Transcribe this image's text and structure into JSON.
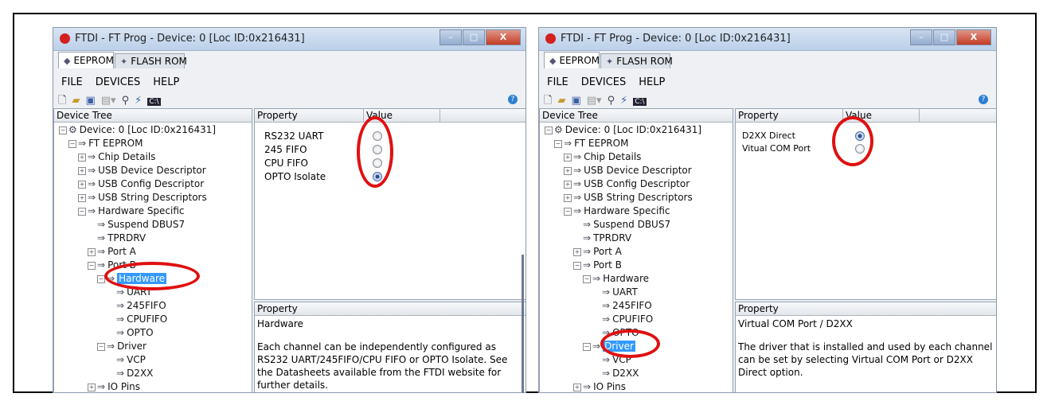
{
  "colors": {
    "highlight": "#e01010",
    "selection": "#3399ff",
    "titlebar": "#c9daef"
  },
  "windows": [
    {
      "title": "FTDI - FT Prog - Device: 0 [Loc ID:0x216431]",
      "controls": [
        "–",
        "□",
        "X"
      ],
      "tabs": [
        "EEPROM",
        "FLASH ROM"
      ],
      "menu": [
        "FILE",
        "DEVICES",
        "HELP"
      ],
      "tree_header": "Device Tree",
      "tree": [
        {
          "label": "Device: 0 [Loc ID:0x216431]",
          "exp": "−",
          "icon": "device-icon"
        },
        {
          "label": "FT EEPROM",
          "exp": "−",
          "icon": "arrow-icon"
        },
        {
          "label": "Chip Details",
          "exp": "+",
          "icon": "arrow-icon"
        },
        {
          "label": "USB Device Descriptor",
          "exp": "+",
          "icon": "arrow-icon"
        },
        {
          "label": "USB Config Descriptor",
          "exp": "+",
          "icon": "arrow-icon"
        },
        {
          "label": "USB String Descriptors",
          "exp": "+",
          "icon": "arrow-icon"
        },
        {
          "label": "Hardware Specific",
          "exp": "−",
          "icon": "arrow-icon"
        },
        {
          "label": "Suspend DBUS7",
          "exp": "",
          "icon": "arrow-icon"
        },
        {
          "label": "TPRDRV",
          "exp": "",
          "icon": "arrow-icon"
        },
        {
          "label": "Port A",
          "exp": "+",
          "icon": "arrow-icon"
        },
        {
          "label": "Port B",
          "exp": "−",
          "icon": "arrow-icon"
        },
        {
          "label": "Hardware",
          "exp": "−",
          "icon": "arrow-icon",
          "selected": true
        },
        {
          "label": "UART",
          "exp": "",
          "icon": "arrow-icon"
        },
        {
          "label": "245FIFO",
          "exp": "",
          "icon": "arrow-icon"
        },
        {
          "label": "CPUFIFO",
          "exp": "",
          "icon": "arrow-icon"
        },
        {
          "label": "OPTO",
          "exp": "",
          "icon": "arrow-icon"
        },
        {
          "label": "Driver",
          "exp": "−",
          "icon": "arrow-icon"
        },
        {
          "label": "VCP",
          "exp": "",
          "icon": "arrow-icon"
        },
        {
          "label": "D2XX",
          "exp": "",
          "icon": "arrow-icon"
        },
        {
          "label": "IO Pins",
          "exp": "+",
          "icon": "arrow-icon"
        }
      ],
      "prop_headers": [
        "Property",
        "Value"
      ],
      "options": [
        {
          "label": "RS232 UART",
          "checked": false
        },
        {
          "label": "245 FIFO",
          "checked": false
        },
        {
          "label": "CPU FIFO",
          "checked": false
        },
        {
          "label": "OPTO Isolate",
          "checked": true
        }
      ],
      "bottom_header": "Property",
      "bottom_title": "Hardware",
      "bottom_desc": "Each channel can be independently configured as RS232 UART/245FIFO/CPU FIFO or OPTO Isolate.  See the Datasheets available from the FTDI website for further details."
    },
    {
      "title": "FTDI - FT Prog - Device: 0 [Loc ID:0x216431]",
      "controls": [
        "–",
        "□",
        "X"
      ],
      "tabs": [
        "EEPROM",
        "FLASH ROM"
      ],
      "menu": [
        "FILE",
        "DEVICES",
        "HELP"
      ],
      "tree_header": "Device Tree",
      "tree": [
        {
          "label": "Device: 0 [Loc ID:0x216431]",
          "exp": "−",
          "icon": "device-icon"
        },
        {
          "label": "FT EEPROM",
          "exp": "−",
          "icon": "arrow-icon"
        },
        {
          "label": "Chip Details",
          "exp": "+",
          "icon": "arrow-icon"
        },
        {
          "label": "USB Device Descriptor",
          "exp": "+",
          "icon": "arrow-icon"
        },
        {
          "label": "USB Config Descriptor",
          "exp": "+",
          "icon": "arrow-icon"
        },
        {
          "label": "USB String Descriptors",
          "exp": "+",
          "icon": "arrow-icon"
        },
        {
          "label": "Hardware Specific",
          "exp": "−",
          "icon": "arrow-icon"
        },
        {
          "label": "Suspend DBUS7",
          "exp": "",
          "icon": "arrow-icon"
        },
        {
          "label": "TPRDRV",
          "exp": "",
          "icon": "arrow-icon"
        },
        {
          "label": "Port A",
          "exp": "+",
          "icon": "arrow-icon"
        },
        {
          "label": "Port B",
          "exp": "−",
          "icon": "arrow-icon"
        },
        {
          "label": "Hardware",
          "exp": "−",
          "icon": "arrow-icon"
        },
        {
          "label": "UART",
          "exp": "",
          "icon": "arrow-icon"
        },
        {
          "label": "245FIFO",
          "exp": "",
          "icon": "arrow-icon"
        },
        {
          "label": "CPUFIFO",
          "exp": "",
          "icon": "arrow-icon"
        },
        {
          "label": "OPTO",
          "exp": "",
          "icon": "arrow-icon"
        },
        {
          "label": "Driver",
          "exp": "−",
          "icon": "arrow-icon",
          "selected": true
        },
        {
          "label": "VCP",
          "exp": "",
          "icon": "arrow-icon"
        },
        {
          "label": "D2XX",
          "exp": "",
          "icon": "arrow-icon"
        },
        {
          "label": "IO Pins",
          "exp": "+",
          "icon": "arrow-icon"
        }
      ],
      "prop_headers": [
        "Property",
        "Value"
      ],
      "options": [
        {
          "label": "D2XX Direct",
          "checked": true
        },
        {
          "label": "Vitual COM Port",
          "checked": false
        }
      ],
      "bottom_header": "Property",
      "bottom_title": "Virtual COM Port / D2XX",
      "bottom_desc": "The driver that is installed and used by each channel can be set by selecting Virtual COM Port or D2XX Direct option."
    }
  ]
}
